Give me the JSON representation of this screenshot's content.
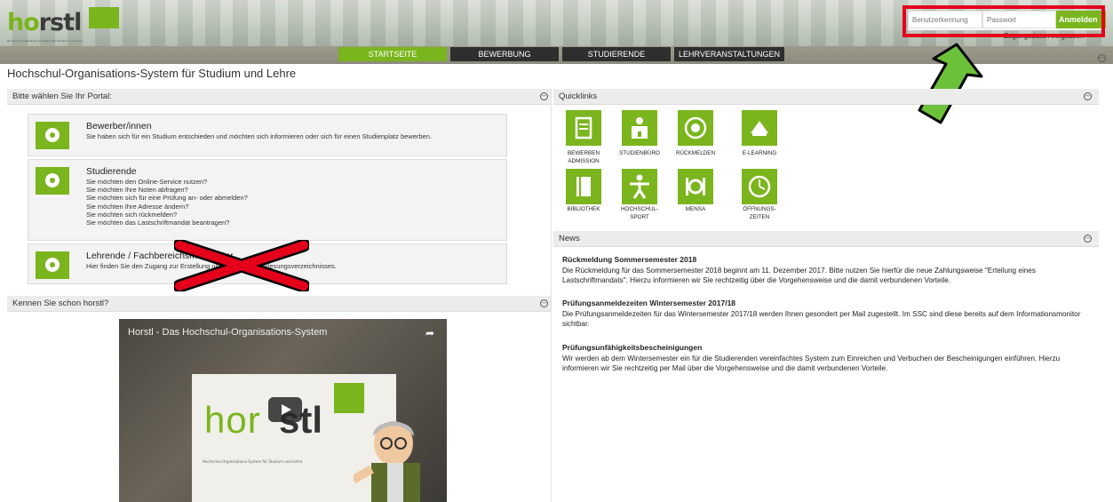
{
  "logo": {
    "prefix": "ho",
    "suffix": "rstl",
    "tagline": "Hochschul-Organisations-System für Studium und Lehre"
  },
  "login": {
    "username_placeholder": "Benutzerkennung",
    "password_placeholder": "Passwort",
    "submit_label": "Anmelden",
    "forgot_link": "Zugangsdaten vergessen"
  },
  "nav": {
    "tabs": [
      {
        "label": "STARTSEITE",
        "active": true
      },
      {
        "label": "BEWERBUNG",
        "active": false
      },
      {
        "label": "STUDIERENDE",
        "active": false
      },
      {
        "label": "LEHRVERANSTALTUNGEN",
        "active": false
      }
    ]
  },
  "page_title": "Hochschul-Organisations-System für Studium und Lehre",
  "portal": {
    "heading": "Bitte wählen Sie Ihr Portal:",
    "items": [
      {
        "title": "Bewerber/innen",
        "lines": [
          "Sie haben sich für ein Studium entschieden und möchten sich informieren oder sich für einen Studienplatz bewerben."
        ]
      },
      {
        "title": "Studierende",
        "lines": [
          "Sie möchten den Online-Service nutzen?",
          "Sie möchten Ihre Noten abfragen?",
          "Sie möchten sich für eine Prüfung an- oder abmelden?",
          "Sie möchten Ihre Adresse ändern?",
          "Sie möchten sich rückmelden?",
          "Sie möchten das Lastschriftmandat beantragen?"
        ]
      },
      {
        "title": "Lehrende / Fachbereichsmitarbeiter",
        "lines": [
          "Hier finden Sie den Zugang zur Erstellung und Pflege des Vorlesungsverzeichnisses."
        ]
      }
    ]
  },
  "kennen": {
    "heading": "Kennen Sie schon horstl?"
  },
  "video": {
    "title": "Horstl - Das Hochschul-Organisations-System",
    "logo_green": "hor",
    "logo_dark": "stl",
    "tagline": "Hochschul-Organisations-System für Studium und Lehre"
  },
  "quicklinks": {
    "heading": "Quicklinks",
    "items": [
      {
        "label": "BEWERBEN\nADMISSION",
        "icon": "document-icon"
      },
      {
        "label": "STUDIENBÜRO",
        "icon": "office-icon"
      },
      {
        "label": "RÜCKMELDEN",
        "icon": "refresh-euro-icon"
      },
      {
        "label": "E-LEARNING",
        "icon": "cloud-icon"
      },
      {
        "label": "BIBLIOTHEK",
        "icon": "book-icon"
      },
      {
        "label": "HOCHSCHUL-\nSPORT",
        "icon": "person-icon"
      },
      {
        "label": "MENSA",
        "icon": "cutlery-icon"
      },
      {
        "label": "ÖFFNUNGS-\nZEITEN",
        "icon": "clock-icon"
      }
    ]
  },
  "news": {
    "heading": "News",
    "items": [
      {
        "title": "Rückmeldung Sommersemester 2018",
        "body": "Die Rückmeldung für das Sommersemester 2018 beginnt am 11. Dezember 2017. Bitte nutzen Sie hierfür die neue Zahlungsweise \"Erteilung eines Lastschriftmandats\". Hierzu informieren wir Sie rechtzeitig über die Vorgehensweise und die damit verbundenen Vorteile."
      },
      {
        "title": "Prüfungsanmeldezeiten Wintersemester 2017/18",
        "body": "Die Prüfungsanmeldezeiten für das Wintersemester 2017/18 werden Ihnen gesondert per Mail zugestellt. Im SSC sind diese bereits auf dem Informationsmonitor sichtbar."
      },
      {
        "title": "Prüfungsunfähigkeitsbescheinigungen",
        "body": "Wir werden ab dem Wintersemester ein für die Studierenden vereinfachtes System zum Einreichen und Verbuchen der Bescheinigungen einführen. Hierzu informieren wir Sie rechtzeitig per Mail über die Vorgehensweise und die damit verbundenen Vorteile."
      }
    ]
  },
  "colors": {
    "brand_green": "#7ab51d",
    "nav_dark": "#2e2e2e",
    "annotation_red": "#e4001b",
    "annotation_arrow": "#6cc13a"
  }
}
